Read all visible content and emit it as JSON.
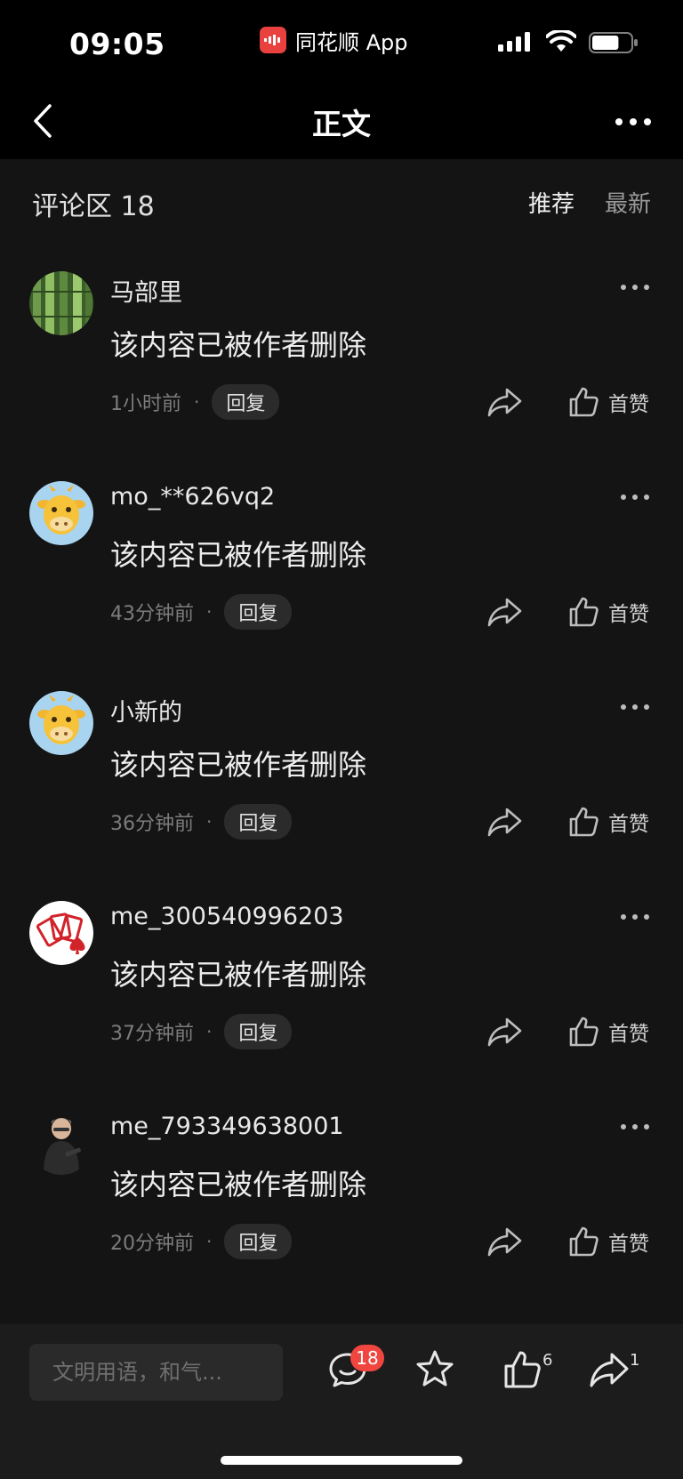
{
  "status_bar": {
    "time": "09:05",
    "app_name": "同花顺 App",
    "battery_level": 0.7
  },
  "nav": {
    "title": "正文",
    "back_icon": "chevron-left-icon",
    "more_icon": "ellipsis-icon"
  },
  "comments_section": {
    "title": "评论区 18",
    "sort_options": [
      "推荐",
      "最新"
    ],
    "active_sort": "推荐"
  },
  "comments": [
    {
      "username": "马部里",
      "avatar": "bamboo-avatar",
      "text": "该内容已被作者删除",
      "time": "1小时前",
      "reply_label": "回复",
      "like_label": "首赞"
    },
    {
      "username": "mo_**626vq2",
      "avatar": "cartoon-cow-avatar",
      "text": "该内容已被作者删除",
      "time": "43分钟前",
      "reply_label": "回复",
      "like_label": "首赞"
    },
    {
      "username": "小新的",
      "avatar": "cartoon-cow-avatar",
      "text": "该内容已被作者删除",
      "time": "36分钟前",
      "reply_label": "回复",
      "like_label": "首赞"
    },
    {
      "username": "me_300540996203",
      "avatar": "playing-cards-avatar",
      "text": "该内容已被作者删除",
      "time": "37分钟前",
      "reply_label": "回复",
      "like_label": "首赞"
    },
    {
      "username": "me_793349638001",
      "avatar": "person-figure-avatar",
      "text": "该内容已被作者删除",
      "time": "20分钟前",
      "reply_label": "回复",
      "like_label": "首赞"
    }
  ],
  "bottom_bar": {
    "input_placeholder": "文明用语，和气...",
    "comment_count": "18",
    "like_count": "6",
    "share_count": "1"
  },
  "colors": {
    "background": "#141414",
    "bar": "#000000",
    "badge": "#f0463f",
    "brand": "#e9413f"
  }
}
